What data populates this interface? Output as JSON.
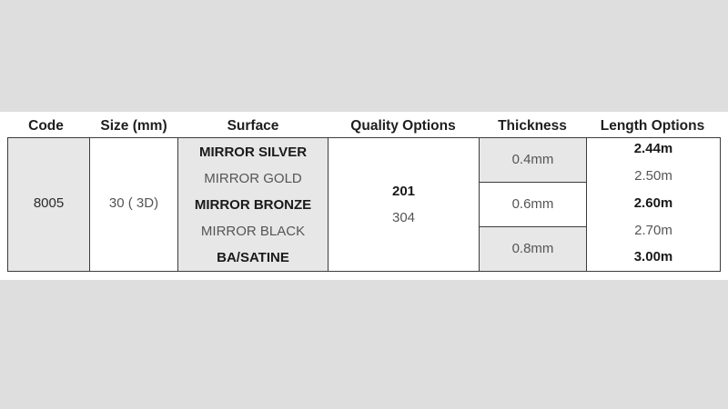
{
  "headers": {
    "code": "Code",
    "size": "Size (mm)",
    "surface": "Surface",
    "quality": "Quality Options",
    "thickness": "Thickness",
    "length": "Length Options"
  },
  "row": {
    "code": "8005",
    "size": "30 ( 3D)",
    "surfaces": [
      "MIRROR  SILVER",
      "MIRROR GOLD",
      "MIRROR BRONZE",
      "MIRROR BLACK",
      "BA/SATINE"
    ],
    "qualities": [
      "201",
      "304"
    ],
    "thicknesses": [
      "0.4mm",
      "0.6mm",
      "0.8mm"
    ],
    "lengths": [
      "2.44m",
      "2.50m",
      "2.60m",
      "2.70m",
      "3.00m"
    ]
  },
  "colors": {
    "background": "#dedede",
    "gray_cell": "#e7e7e7",
    "border": "#3c3c3c"
  }
}
